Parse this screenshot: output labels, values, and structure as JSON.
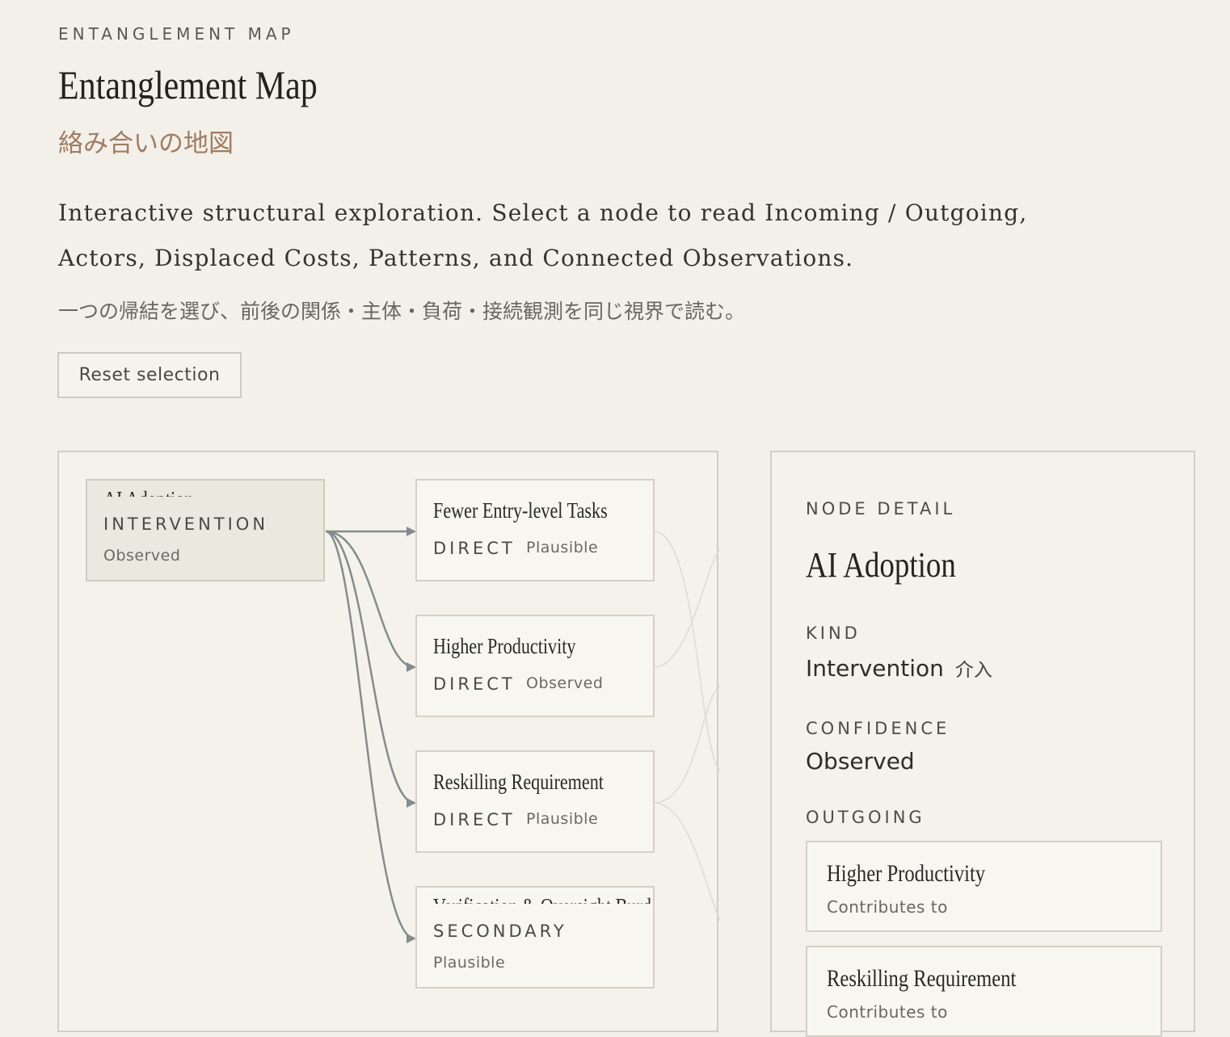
{
  "header": {
    "eyebrow": "ENTANGLEMENT MAP",
    "title": "Entanglement Map",
    "title_jp": "絡み合いの地図",
    "intro": "Interactive structural exploration. Select a node to read Incoming / Outgoing, Actors, Displaced Costs, Patterns, and Connected Observations.",
    "intro_jp": "一つの帰結を選び、前後の関係・主体・負荷・接続観測を同じ視界で読む。"
  },
  "controls": {
    "reset_label": "Reset selection"
  },
  "map": {
    "source_node": {
      "title": "AI Adoption",
      "kind": "INTERVENTION",
      "confidence": "Observed"
    },
    "targets": [
      {
        "title": "Fewer Entry-level Tasks",
        "kind": "DIRECT",
        "confidence": "Plausible"
      },
      {
        "title": "Higher Productivity",
        "kind": "DIRECT",
        "confidence": "Observed"
      },
      {
        "title": "Reskilling Requirement",
        "kind": "DIRECT",
        "confidence": "Plausible"
      },
      {
        "title": "Verification & Oversight Burden",
        "kind": "SECONDARY",
        "confidence": "Plausible"
      }
    ]
  },
  "detail": {
    "eyebrow": "NODE DETAIL",
    "title": "AI Adoption",
    "kind_label": "KIND",
    "kind_value": "Intervention",
    "kind_value_jp": "介入",
    "confidence_label": "CONFIDENCE",
    "confidence_value": "Observed",
    "outgoing_label": "OUTGOING",
    "outgoing": [
      {
        "title": "Higher Productivity",
        "relation": "Contributes to"
      },
      {
        "title": "Reskilling Requirement",
        "relation": "Contributes to"
      }
    ]
  },
  "colors": {
    "background": "#f3f0e9",
    "accent": "#a07c62",
    "link": "#838c8f"
  }
}
